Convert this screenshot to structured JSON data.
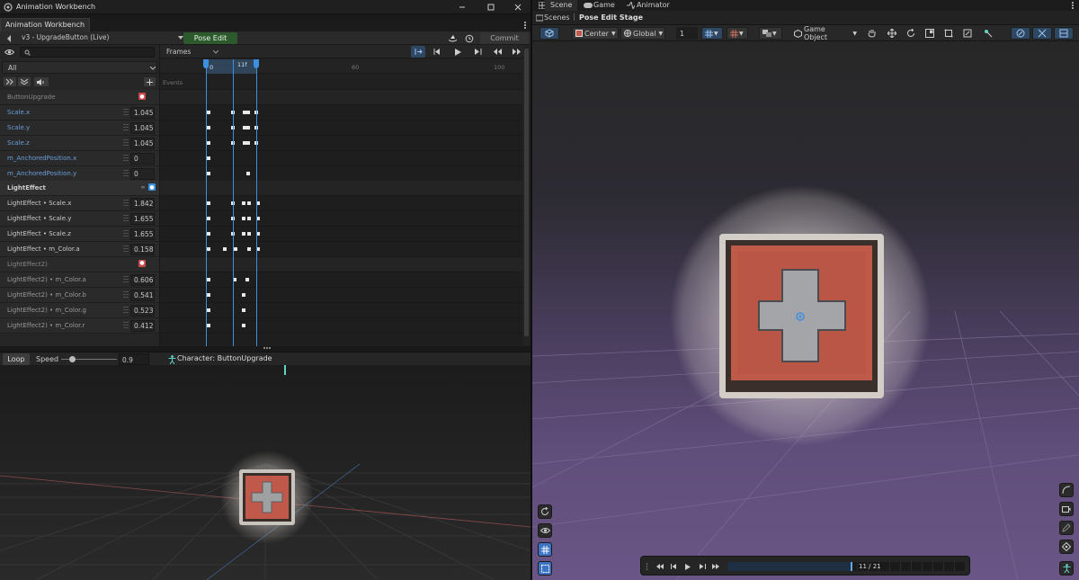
{
  "window": {
    "title": "Animation Workbench"
  },
  "tab": {
    "label": "Animation Workbench"
  },
  "toolbar": {
    "clip": "v3 - UpgradeButton (Live)",
    "pose_edit": "Pose Edit",
    "commit": "Commit",
    "filter": "All",
    "timeline_mode": "Frames"
  },
  "timeline": {
    "ruler_labels": [
      "0",
      "60",
      "100"
    ],
    "current_frame": "11f",
    "events_label": "Events"
  },
  "tracks": [
    {
      "label": "ButtonUpgrade",
      "kind": "group-dim"
    },
    {
      "label": "Scale.x",
      "value": "1.045",
      "kind": "prop"
    },
    {
      "label": "Scale.y",
      "value": "1.045",
      "kind": "prop"
    },
    {
      "label": "Scale.z",
      "value": "1.045",
      "kind": "prop"
    },
    {
      "label": "m_AnchoredPosition.x",
      "value": "0",
      "kind": "prop"
    },
    {
      "label": "m_AnchoredPosition.y",
      "value": "0",
      "kind": "prop"
    },
    {
      "label": "LightEffect",
      "kind": "group"
    },
    {
      "label": "LightEffect • Scale.x",
      "value": "1.842",
      "kind": "sub"
    },
    {
      "label": "LightEffect • Scale.y",
      "value": "1.655",
      "kind": "sub"
    },
    {
      "label": "LightEffect • Scale.z",
      "value": "1.655",
      "kind": "sub"
    },
    {
      "label": "LightEffect • m_Color.a",
      "value": "0.158",
      "kind": "sub"
    },
    {
      "label": "LightEffect2)",
      "kind": "group-dim"
    },
    {
      "label": "LightEffect2) • m_Color.a",
      "value": "0.606",
      "kind": "sub2"
    },
    {
      "label": "LightEffect2) • m_Color.b",
      "value": "0.541",
      "kind": "sub2"
    },
    {
      "label": "LightEffect2) • m_Color.g",
      "value": "0.523",
      "kind": "sub2"
    },
    {
      "label": "LightEffect2) • m_Color.r",
      "value": "0.412",
      "kind": "sub2"
    }
  ],
  "playback": {
    "loop": "Loop",
    "speed_label": "Speed",
    "speed_value": "0.9",
    "speed_fraction": 0.2,
    "character": "Character: ButtonUpgrade"
  },
  "scene": {
    "tabs": [
      "Scene",
      "Game",
      "Animator"
    ],
    "breadcrumb_root": "Scenes",
    "breadcrumb_stage": "Pose Edit Stage",
    "pivot": "Center",
    "space": "Global",
    "snap_value": "1",
    "view_mode": "Game Object",
    "frame_counter": "11 / 21",
    "frame_fraction": 0.524
  },
  "colors": {
    "accent": "#3d8fe0",
    "pose_green": "#2c5a2c",
    "scene_purple": "#6a5686"
  }
}
